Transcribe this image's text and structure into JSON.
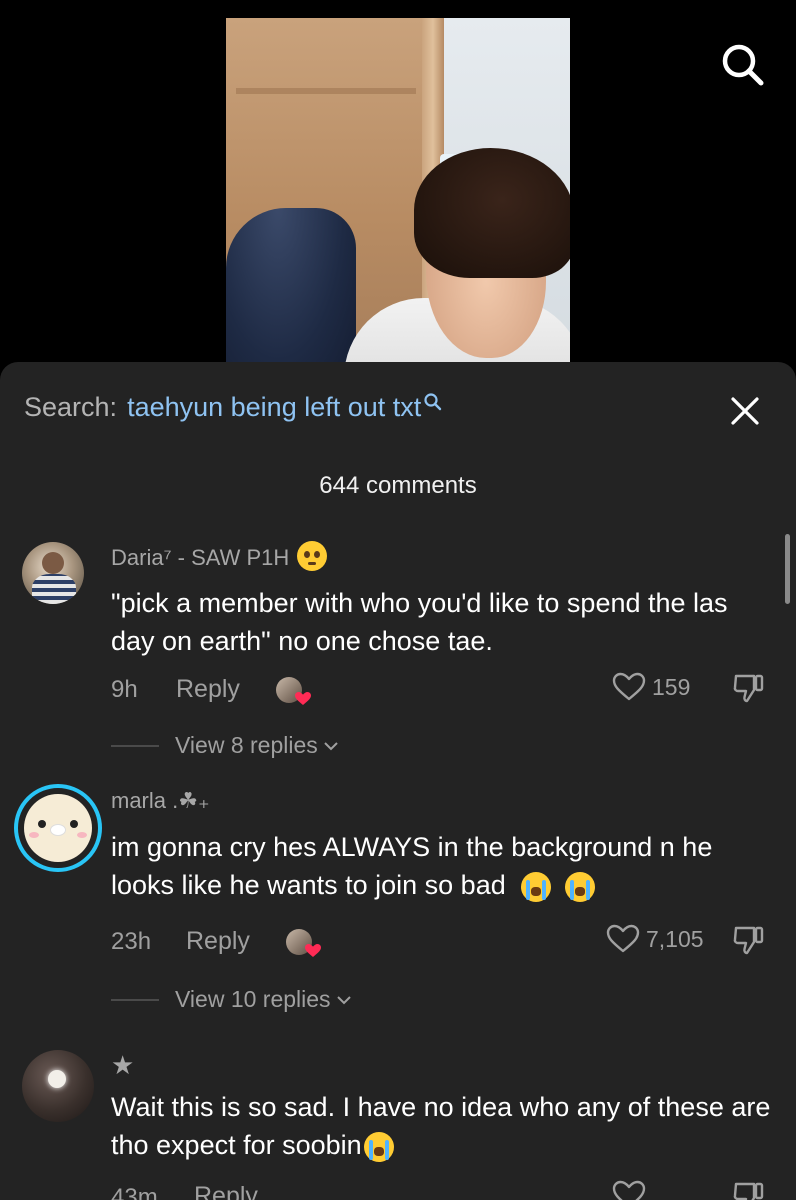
{
  "video": {
    "label": ""
  },
  "search": {
    "label": "Search:",
    "query": "taehyun being left out txt"
  },
  "comments_count": "644 comments",
  "comments": [
    {
      "username": "Daria⁷ - SAW P1H",
      "text": "\"pick a member with who you'd like to spend the las day on earth\" no one chose tae.",
      "time": "9h",
      "reply_label": "Reply",
      "likes": "159",
      "view_replies": "View 8 replies"
    },
    {
      "username": "marla .☘︎₊",
      "text": "im gonna cry hes ALWAYS in the background n he looks like he wants to join so bad",
      "time": "23h",
      "reply_label": "Reply",
      "likes": "7,105",
      "view_replies": "View 10 replies"
    },
    {
      "username": "★",
      "text": "Wait this is so sad. I have no idea who any of these are tho expect for soobin",
      "time": "43m",
      "reply_label": "Reply",
      "likes": "",
      "view_replies": ""
    }
  ],
  "icons": {
    "top_search": "search-icon",
    "close": "close-icon",
    "like": "heart-outline-icon",
    "dislike": "thumbs-down-icon",
    "chevron": "chevron-down-icon"
  },
  "colors": {
    "sheet_bg": "#232323",
    "query_blue": "#8fc3f2",
    "muted_text": "#a0a0a0",
    "story_ring": "#29c5f6"
  }
}
